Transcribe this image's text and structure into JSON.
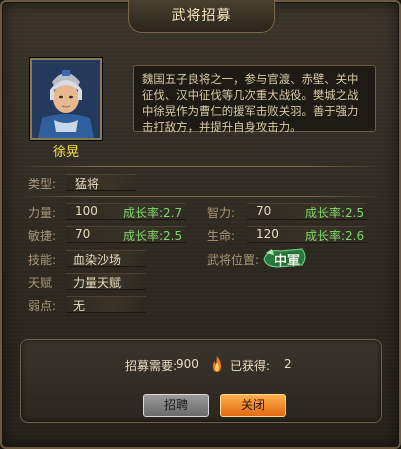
{
  "window": {
    "title": "武将招募"
  },
  "general": {
    "name": "徐晃",
    "description": "魏国五子良将之一，参与官渡、赤壁、关中征伐、汉中征伐等几次重大战役。樊城之战中徐晃作为曹仁的援军击败关羽。善于强力击打敌方，并提升自身攻击力。"
  },
  "stats": {
    "type_label": "类型:",
    "type_value": "猛将",
    "strength_label": "力量:",
    "strength_value": "100",
    "strength_rate": "成长率:2.7",
    "agility_label": "敏捷:",
    "agility_value": "70",
    "agility_rate": "成长率:2.5",
    "intellect_label": "智力:",
    "intellect_value": "70",
    "intellect_rate": "成长率:2.5",
    "life_label": "生命:",
    "life_value": "120",
    "life_rate": "成长率:2.6",
    "skill_label": "技能:",
    "skill_value": "血染沙场",
    "talent_label": "天赋",
    "talent_value": "力量天赋",
    "weakness_label": "弱点:",
    "weakness_value": "无",
    "position_label": "武将位置:",
    "position_value": "中軍"
  },
  "recruit": {
    "need_label": "招募需要:",
    "need_value": "900",
    "owned_label": "已获得:",
    "owned_value": "2"
  },
  "buttons": {
    "recruit": "招聘",
    "close": "关闭"
  },
  "colors": {
    "accent_green": "#7fd86a",
    "name_yellow": "#f5e24a",
    "close_orange": "#f08a20"
  }
}
